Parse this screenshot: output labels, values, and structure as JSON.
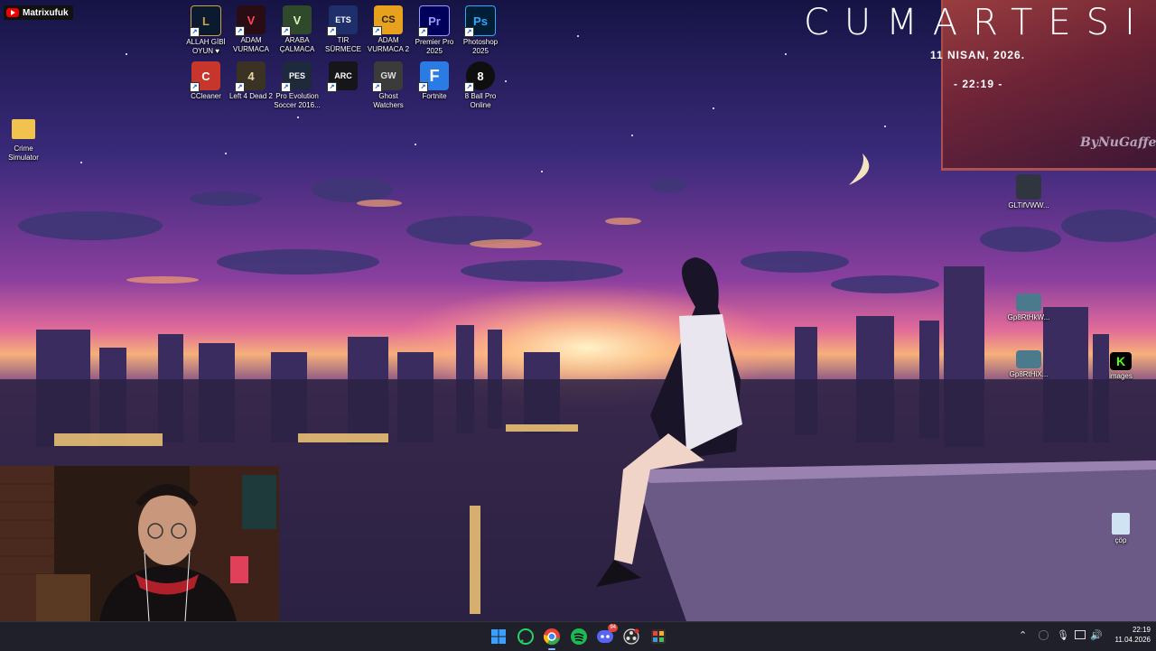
{
  "overlay": {
    "channel_name": "Matrixufuk"
  },
  "clock_widget": {
    "day": "CUMARTESI",
    "date": "11 NISAN, 2026.",
    "time": "- 22:19 -",
    "signature": "ByNuGaffe"
  },
  "desktop_icons_top": [
    {
      "label": "ALLAH GİBİ OYUN ♥",
      "icon": "league-of-legends-icon",
      "color": "#0b1a2e",
      "glyph": "L"
    },
    {
      "label": "ADAM VURMACA",
      "icon": "valorant-icon",
      "color": "#2a0d14",
      "glyph": "V"
    },
    {
      "label": "ARABA ÇALMACA",
      "icon": "gta-v-icon",
      "color": "#2f4a2a",
      "glyph": "V"
    },
    {
      "label": "TIR SÜRMECE",
      "icon": "euro-truck-simulator-icon",
      "color": "#1f2f6b",
      "glyph": "ETS"
    },
    {
      "label": "ADAM VURMACA 2",
      "icon": "counter-strike-icon",
      "color": "#e7a11c",
      "glyph": "CS"
    },
    {
      "label": "Premier Pro 2025",
      "icon": "premiere-pro-icon",
      "color": "#00005b",
      "glyph": "Pr"
    },
    {
      "label": "Photoshop 2025",
      "icon": "photoshop-icon",
      "color": "#001e36",
      "glyph": "Ps"
    }
  ],
  "desktop_icons_row2": [
    {
      "label": "CCleaner",
      "icon": "ccleaner-icon",
      "color": "#c8352b",
      "glyph": "C"
    },
    {
      "label": "Left 4 Dead 2",
      "icon": "left-4-dead-2-icon",
      "color": "#3a3222",
      "glyph": "4"
    },
    {
      "label": "Pro Evolution Soccer 2016...",
      "icon": "pes-2016-icon",
      "color": "#1e2a3c",
      "glyph": "PES"
    },
    {
      "label": "",
      "icon": "arc-raiders-icon",
      "color": "#15151a",
      "glyph": "ARC"
    },
    {
      "label": "Ghost Watchers",
      "icon": "ghost-watchers-icon",
      "color": "#3b3b3b",
      "glyph": "GW"
    },
    {
      "label": "Fortnite",
      "icon": "fortnite-icon",
      "color": "#2a7be4",
      "glyph": "F"
    },
    {
      "label": "8 Ball Pro Online",
      "icon": "eight-ball-icon",
      "color": "#0f0f0f",
      "glyph": "8"
    }
  ],
  "left_icon": {
    "label": "Crime Simulator",
    "icon": "folder-icon"
  },
  "right_icons": [
    {
      "label": "GLTifVWW...",
      "icon": "image-file-icon"
    },
    {
      "label": "Gp8RtHkW...",
      "icon": "image-file-icon"
    },
    {
      "label": "Gp8RtHiX...",
      "icon": "image-file-icon"
    },
    {
      "label": "images",
      "icon": "kick-icon"
    },
    {
      "label": "çöp",
      "icon": "recycle-bin-icon"
    }
  ],
  "taskbar": {
    "apps": [
      {
        "name": "windows-start-icon",
        "color": "#3aa0ff"
      },
      {
        "name": "whatsapp-icon",
        "color": "#25d366"
      },
      {
        "name": "chrome-icon",
        "color": "#ea4335"
      },
      {
        "name": "spotify-icon",
        "color": "#1db954"
      },
      {
        "name": "discord-icon",
        "color": "#5865f2"
      },
      {
        "name": "obs-icon",
        "color": "#4a4a4a"
      },
      {
        "name": "snipping-tool-icon",
        "color": "#d64a3a"
      }
    ],
    "discord_badge": "94",
    "time": "22:19",
    "date": "11.04.2026"
  },
  "colors": {
    "sky_top": "#1c1850",
    "sky_mid": "#7b3fa0",
    "horizon": "#f2a96a",
    "taskbar": "#1f2029"
  }
}
